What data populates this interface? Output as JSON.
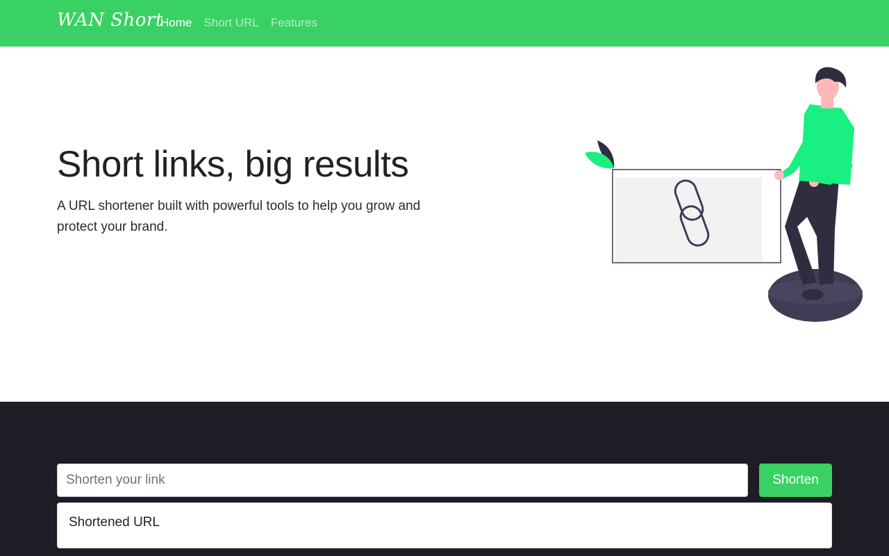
{
  "navbar": {
    "brand": "WAN Short",
    "links": [
      {
        "label": "Home",
        "active": true
      },
      {
        "label": "Short URL",
        "active": false
      },
      {
        "label": "Features",
        "active": false
      }
    ],
    "background_color": "#39d163"
  },
  "hero": {
    "title": "Short links, big results",
    "subtitle": "A URL shortener built with powerful tools to help you grow and protect your brand.",
    "illustration": "person-with-link-card-illustration"
  },
  "shortener": {
    "input_placeholder": "Shorten your link",
    "input_value": "",
    "button_label": "Shorten",
    "result_title": "Shortened URL",
    "section_background": "#1e1c25",
    "accent_color": "#39d163"
  }
}
